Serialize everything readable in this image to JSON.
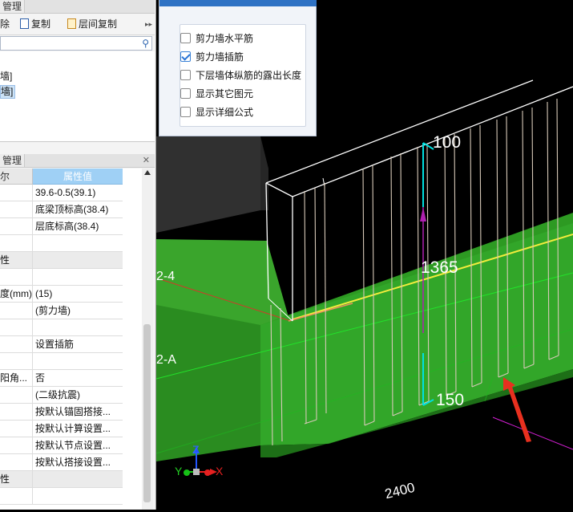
{
  "dialog": {
    "options": [
      {
        "label": "剪力墙水平筋",
        "checked": false
      },
      {
        "label": "剪力墙插筋",
        "checked": true
      },
      {
        "label": "下层墙体纵筋的露出长度",
        "checked": false
      },
      {
        "label": "显示其它图元",
        "checked": false
      },
      {
        "label": "显示详细公式",
        "checked": false
      }
    ]
  },
  "left_panel": {
    "top_tab": "管理",
    "toolbar": {
      "delete_label": "除",
      "copy_label": "复制",
      "floor_copy_label": "层间复制",
      "overflow": "▸▸"
    },
    "tree_items": [
      {
        "label": "墙]",
        "selected": false
      },
      {
        "label": "墙]",
        "selected": true
      }
    ],
    "props_tab": "管理",
    "props_header": {
      "name_col": "尔",
      "value_col": "属性值"
    },
    "rows": [
      {
        "name": "",
        "value": "39.6-0.5(39.1)",
        "group": false
      },
      {
        "name": "",
        "value": "底梁顶标高(38.4)",
        "group": false
      },
      {
        "name": "",
        "value": "层底标高(38.4)",
        "group": false
      },
      {
        "name": "",
        "value": "",
        "group": false
      },
      {
        "name": "性",
        "value": "",
        "group": true
      },
      {
        "name": "",
        "value": "",
        "group": false
      },
      {
        "name": "度(mm)",
        "value": "(15)",
        "group": false
      },
      {
        "name": "",
        "value": "(剪力墙)",
        "group": false
      },
      {
        "name": "",
        "value": "",
        "group": false
      },
      {
        "name": "",
        "value": "设置插筋",
        "group": false
      },
      {
        "name": "",
        "value": "",
        "group": false
      },
      {
        "name": "阳角...",
        "value": "否",
        "group": false
      },
      {
        "name": "",
        "value": "(二级抗震)",
        "group": false
      },
      {
        "name": "",
        "value": "按默认锚固搭接...",
        "group": false
      },
      {
        "name": "",
        "value": "按默认计算设置...",
        "group": false
      },
      {
        "name": "",
        "value": "按默认节点设置...",
        "group": false
      },
      {
        "name": "",
        "value": "按默认搭接设置...",
        "group": false
      },
      {
        "name": "性",
        "value": "",
        "group": true
      },
      {
        "name": "",
        "value": "",
        "group": false
      }
    ]
  },
  "viewport": {
    "dim_top": "100",
    "dim_mid": "1365",
    "dim_bottom": "150",
    "dim_length": "2400",
    "grid_a": "2-4",
    "grid_b": "2-A",
    "axis_x": "X",
    "axis_y": "Y",
    "axis_z": "Z",
    "colors": {
      "concrete": "#3cab2d",
      "rebar": "#ffffff",
      "dimension": "#00e6e6",
      "arrow": "#e8301f"
    }
  }
}
